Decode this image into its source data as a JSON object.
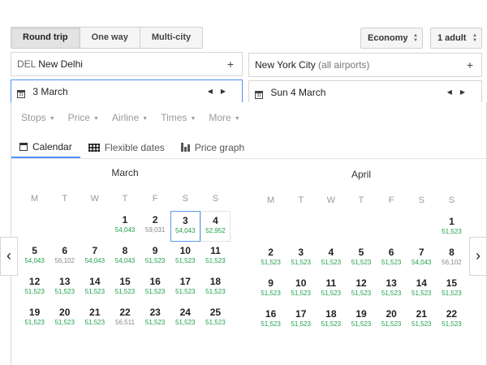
{
  "trip_types": [
    {
      "label": "Round trip",
      "active": true
    },
    {
      "label": "One way",
      "active": false
    },
    {
      "label": "Multi-city",
      "active": false
    }
  ],
  "cabin": {
    "label": "Economy"
  },
  "passengers": {
    "label": "1 adult"
  },
  "origin": {
    "code": "DEL",
    "city": "New Delhi",
    "add": "+"
  },
  "destination": {
    "city": "New York City",
    "note": "(all airports)",
    "add": "+"
  },
  "depart": {
    "label": "3 March",
    "icon_text": "31"
  },
  "return": {
    "label": "Sun 4 March",
    "icon_text": "31"
  },
  "arrows": {
    "prev": "◀",
    "next": "▶"
  },
  "filters": [
    "Stops",
    "Price",
    "Airline",
    "Times",
    "More"
  ],
  "view_tabs": [
    {
      "label": "Calendar",
      "active": true
    },
    {
      "label": "Flexible dates",
      "active": false
    },
    {
      "label": "Price graph",
      "active": false
    }
  ],
  "weekdays": [
    "M",
    "T",
    "W",
    "T",
    "F",
    "S",
    "S"
  ],
  "months": [
    {
      "name": "March",
      "weeks": [
        [
          null,
          null,
          null,
          {
            "d": "1",
            "p": "54,043",
            "c": "green"
          },
          {
            "d": "2",
            "p": "59,031",
            "c": "gray"
          },
          {
            "d": "3",
            "p": "54,043",
            "c": "green",
            "sel": true
          },
          {
            "d": "4",
            "p": "52,952",
            "c": "green",
            "out": true
          }
        ],
        [
          {
            "d": "5",
            "p": "54,043",
            "c": "green"
          },
          {
            "d": "6",
            "p": "56,102",
            "c": "gray"
          },
          {
            "d": "7",
            "p": "54,043",
            "c": "green"
          },
          {
            "d": "8",
            "p": "54,043",
            "c": "green"
          },
          {
            "d": "9",
            "p": "51,523",
            "c": "green"
          },
          {
            "d": "10",
            "p": "51,523",
            "c": "green"
          },
          {
            "d": "11",
            "p": "51,523",
            "c": "green"
          }
        ],
        [
          {
            "d": "12",
            "p": "51,523",
            "c": "green"
          },
          {
            "d": "13",
            "p": "51,523",
            "c": "green"
          },
          {
            "d": "14",
            "p": "51,523",
            "c": "green"
          },
          {
            "d": "15",
            "p": "51,523",
            "c": "green"
          },
          {
            "d": "16",
            "p": "51,523",
            "c": "green"
          },
          {
            "d": "17",
            "p": "51,523",
            "c": "green"
          },
          {
            "d": "18",
            "p": "51,523",
            "c": "green"
          }
        ],
        [
          {
            "d": "19",
            "p": "51,523",
            "c": "green"
          },
          {
            "d": "20",
            "p": "51,523",
            "c": "green"
          },
          {
            "d": "21",
            "p": "51,523",
            "c": "green"
          },
          {
            "d": "22",
            "p": "56,511",
            "c": "gray"
          },
          {
            "d": "23",
            "p": "51,523",
            "c": "green"
          },
          {
            "d": "24",
            "p": "51,523",
            "c": "green"
          },
          {
            "d": "25",
            "p": "51,523",
            "c": "green"
          }
        ]
      ]
    },
    {
      "name": "April",
      "weeks": [
        [
          null,
          null,
          null,
          null,
          null,
          null,
          {
            "d": "1",
            "p": "51,523",
            "c": "green"
          }
        ],
        [
          {
            "d": "2",
            "p": "51,523",
            "c": "green"
          },
          {
            "d": "3",
            "p": "51,523",
            "c": "green"
          },
          {
            "d": "4",
            "p": "51,523",
            "c": "green"
          },
          {
            "d": "5",
            "p": "51,523",
            "c": "green"
          },
          {
            "d": "6",
            "p": "51,523",
            "c": "green"
          },
          {
            "d": "7",
            "p": "54,043",
            "c": "green"
          },
          {
            "d": "8",
            "p": "56,102",
            "c": "gray"
          }
        ],
        [
          {
            "d": "9",
            "p": "51,523",
            "c": "green"
          },
          {
            "d": "10",
            "p": "51,523",
            "c": "green"
          },
          {
            "d": "11",
            "p": "51,523",
            "c": "green"
          },
          {
            "d": "12",
            "p": "51,523",
            "c": "green"
          },
          {
            "d": "13",
            "p": "51,523",
            "c": "green"
          },
          {
            "d": "14",
            "p": "51,523",
            "c": "green"
          },
          {
            "d": "15",
            "p": "51,523",
            "c": "green"
          }
        ],
        [
          {
            "d": "16",
            "p": "51,523",
            "c": "green"
          },
          {
            "d": "17",
            "p": "51,523",
            "c": "green"
          },
          {
            "d": "18",
            "p": "51,523",
            "c": "green"
          },
          {
            "d": "19",
            "p": "51,523",
            "c": "green"
          },
          {
            "d": "20",
            "p": "51,523",
            "c": "green"
          },
          {
            "d": "21",
            "p": "51,523",
            "c": "green"
          },
          {
            "d": "22",
            "p": "51,523",
            "c": "green"
          }
        ]
      ]
    }
  ],
  "calendar_nav": {
    "prev": "‹",
    "next": "›"
  },
  "colors": {
    "price_low": "#1fa04c",
    "price_high": "#888888",
    "focus": "#4d90fe"
  }
}
